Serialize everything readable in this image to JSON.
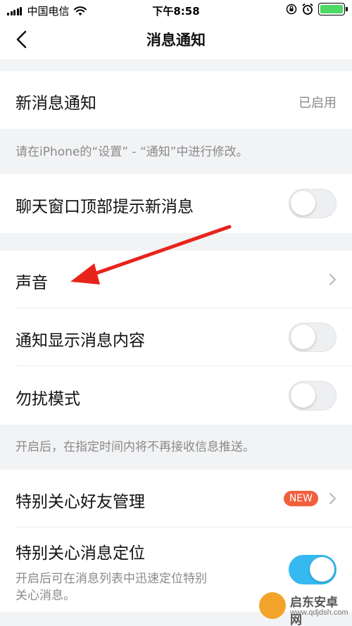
{
  "status_bar": {
    "carrier": "中国电信",
    "time": "下午8:58"
  },
  "nav": {
    "title": "消息通知"
  },
  "settings": {
    "new_message_notify": {
      "label": "新消息通知",
      "value": "已启用"
    },
    "hint_iphone": "请在iPhone的“设置” - “通知”中进行修改。",
    "chat_top_prompt": {
      "label": "聊天窗口顶部提示新消息",
      "toggle": false
    },
    "sound": {
      "label": "声音"
    },
    "show_content": {
      "label": "通知显示消息内容",
      "toggle": false
    },
    "dnd": {
      "label": "勿扰模式",
      "toggle": false
    },
    "hint_dnd": "开启后，在指定时间内将不再接收信息推送。",
    "special_friends": {
      "label": "特别关心好友管理",
      "badge": "NEW"
    },
    "special_locate": {
      "label": "特别关心消息定位",
      "desc_line1": "开启后可在消息列表中迅速定位特别",
      "desc_line2": "关心消息。",
      "toggle": true
    }
  },
  "watermark": {
    "name": "启东安卓网",
    "url": "www.qdjdsh.com"
  },
  "colors": {
    "toggle_on": "#35b9f0",
    "badge": "#f0603e",
    "arrow": "#e8231c",
    "battery": "#4cd964"
  }
}
